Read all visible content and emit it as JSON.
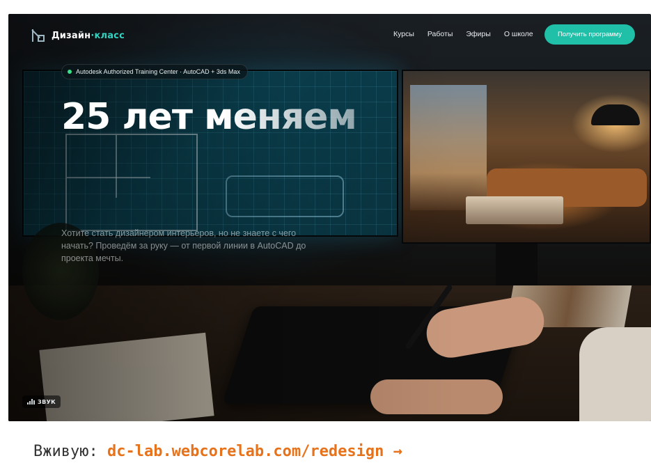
{
  "brand": {
    "name": "Дизайн",
    "accent": "·класс"
  },
  "nav": {
    "items": [
      "Курсы",
      "Работы",
      "Эфиры",
      "О школе"
    ],
    "cta": "Получить программу"
  },
  "hero": {
    "badge": "Autodesk Authorized Training Center · AutoCAD + 3ds Max",
    "headline": "25 лет меняем",
    "lead": "Хотите стать дизайнером интерьеров, но не знаете с чего начать? Проведём за руку — от первой линии в AutoCAD до проекта мечты."
  },
  "sound": {
    "label": "ЗВУК",
    "icon": "sound-bars-icon"
  },
  "caption": {
    "prefix": "Вживую:",
    "link": "dc-lab.webcorelab.com/redesign",
    "arrow": "→"
  },
  "colors": {
    "accent": "#1fbfa8",
    "link": "#e6731c",
    "live_dot": "#38e08a"
  }
}
